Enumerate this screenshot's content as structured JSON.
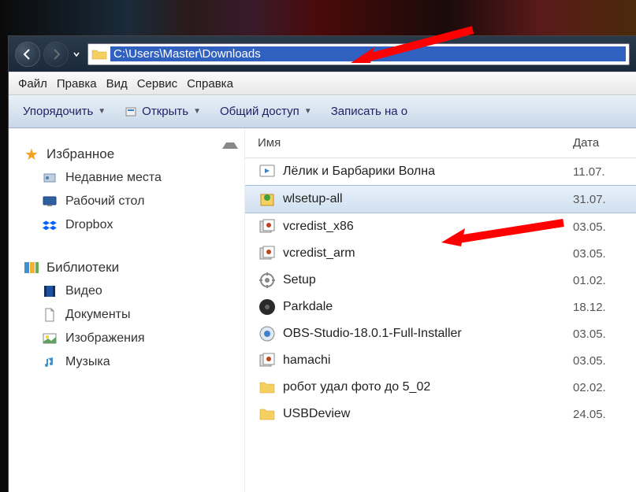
{
  "address": {
    "path": "C:\\Users\\Master\\Downloads"
  },
  "menu": {
    "file": "Файл",
    "edit": "Правка",
    "view": "Вид",
    "tools": "Сервис",
    "help": "Справка"
  },
  "toolbar": {
    "organize": "Упорядочить",
    "open": "Открыть",
    "share": "Общий доступ",
    "burn": "Записать на о"
  },
  "sidebar": {
    "favorites": {
      "label": "Избранное",
      "recent": "Недавние места",
      "desktop": "Рабочий стол",
      "dropbox": "Dropbox"
    },
    "libraries": {
      "label": "Библиотеки",
      "video": "Видео",
      "documents": "Документы",
      "pictures": "Изображения",
      "music": "Музыка"
    }
  },
  "columns": {
    "name": "Имя",
    "date": "Дата"
  },
  "files": [
    {
      "name": "Лёлик и Барбарики Волна",
      "date": "11.07.",
      "icon": "media",
      "selected": false
    },
    {
      "name": "wlsetup-all",
      "date": "31.07.",
      "icon": "installer-green",
      "selected": true
    },
    {
      "name": "vcredist_x86",
      "date": "03.05.",
      "icon": "installer",
      "selected": false
    },
    {
      "name": "vcredist_arm",
      "date": "03.05.",
      "icon": "installer",
      "selected": false
    },
    {
      "name": "Setup",
      "date": "01.02.",
      "icon": "gear",
      "selected": false
    },
    {
      "name": "Parkdale",
      "date": "18.12.",
      "icon": "disc",
      "selected": false
    },
    {
      "name": "OBS-Studio-18.0.1-Full-Installer",
      "date": "03.05.",
      "icon": "installer-blue",
      "selected": false
    },
    {
      "name": "hamachi",
      "date": "03.05.",
      "icon": "installer",
      "selected": false
    },
    {
      "name": "робот удал фото до 5_02",
      "date": "02.02.",
      "icon": "folder",
      "selected": false
    },
    {
      "name": "USBDeview",
      "date": "24.05.",
      "icon": "folder",
      "selected": false
    }
  ]
}
